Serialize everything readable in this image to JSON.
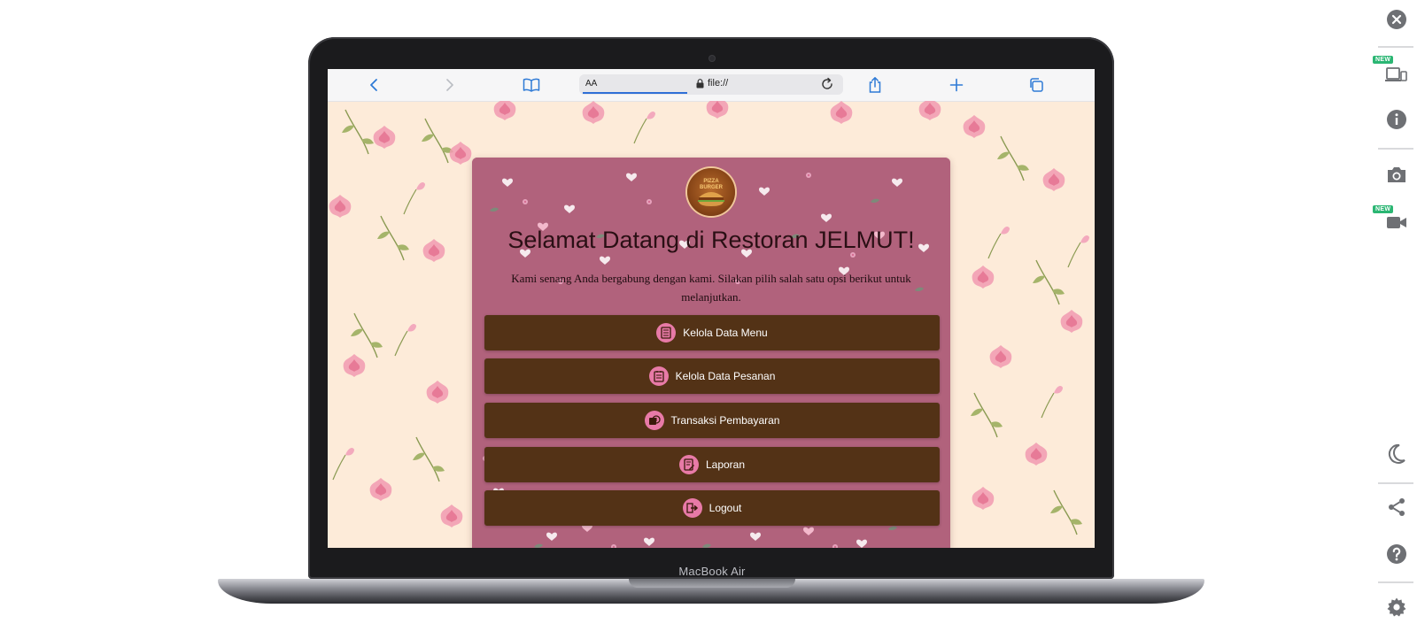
{
  "device": {
    "model_label": "MacBook Air"
  },
  "browser": {
    "text_size_label": "AA",
    "url": "file://",
    "icons": {
      "back": "chevron-left-icon",
      "forward": "chevron-right-icon",
      "bookmarks": "book-icon",
      "secure": "lock-icon",
      "reload": "reload-icon",
      "share": "share-icon",
      "new_tab": "plus-icon",
      "tabs": "tabs-icon"
    },
    "accent_color": "#2e6fd6"
  },
  "page": {
    "logo_alt": "pizza-burger-logo",
    "logo_text_top": "PIZZA",
    "logo_text_mid": "BURGER",
    "title": "Selamat Datang di Restoran JELMUT!",
    "subtitle": "Kami senang Anda bergabung dengan kami. Silakan pilih salah satu opsi berikut untuk melanjutkan.",
    "buttons": [
      {
        "label": "Kelola Data Menu",
        "icon": "menu-list-icon"
      },
      {
        "label": "Kelola Data Pesanan",
        "icon": "order-list-icon"
      },
      {
        "label": "Transaksi Pembayaran",
        "icon": "payment-icon"
      },
      {
        "label": "Laporan",
        "icon": "report-icon"
      },
      {
        "label": "Logout",
        "icon": "logout-icon"
      }
    ],
    "colors": {
      "background": "#fdebd9",
      "card": "#b5667f",
      "button": "#533216",
      "icon_accent": "#e87aa7"
    }
  },
  "right_toolbar": {
    "new_badge_label": "NEW",
    "items": [
      {
        "icon": "close-icon"
      },
      {
        "icon": "responsive-devices-icon",
        "badge": "NEW"
      },
      {
        "icon": "info-icon"
      },
      {
        "icon": "camera-icon"
      },
      {
        "icon": "video-icon",
        "badge": "NEW"
      },
      {
        "icon": "dark-mode-icon"
      },
      {
        "icon": "share-icon"
      },
      {
        "icon": "help-icon"
      },
      {
        "icon": "settings-icon"
      }
    ]
  }
}
